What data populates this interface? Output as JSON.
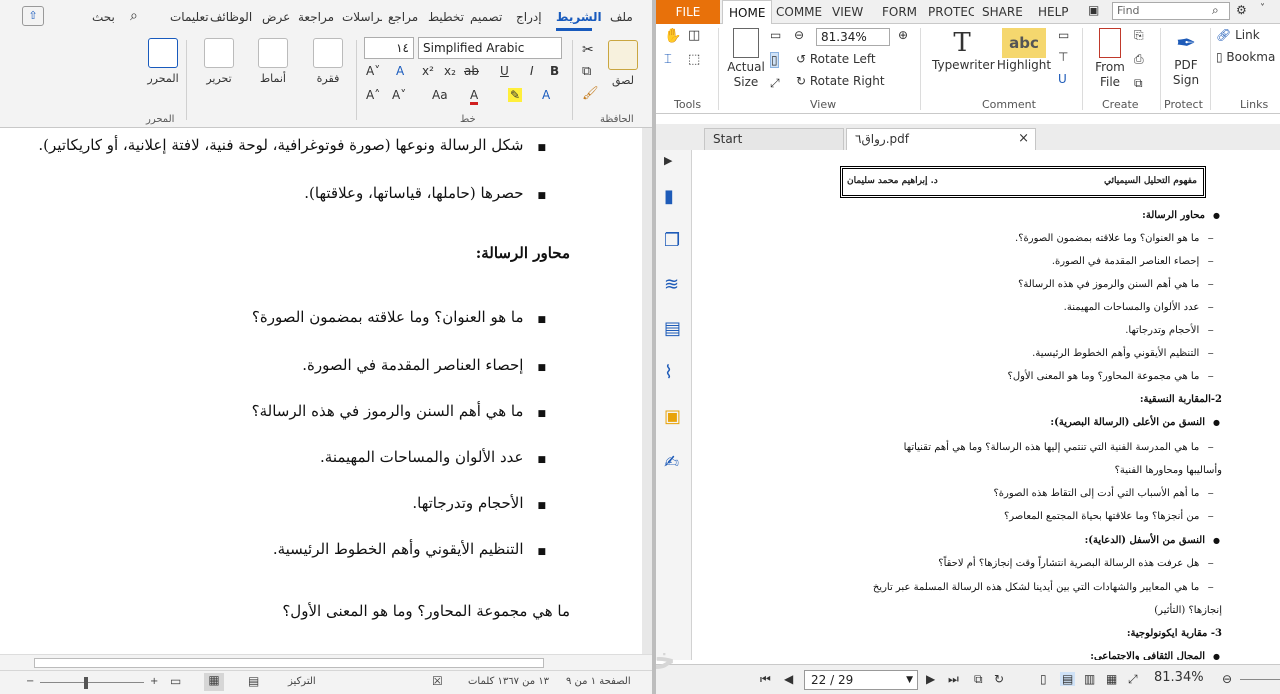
{
  "word": {
    "tabs": [
      "ملف",
      "الشريط",
      "إدراج",
      "تصميم",
      "تخطيط",
      "مراجع",
      "مراسلات",
      "مراجعة",
      "عرض",
      "الوظائف",
      "تعليمات",
      "بحث"
    ],
    "active_tab": "الشريط",
    "ribbon": {
      "paste": "لصق",
      "clipboard_group": "الحافظة",
      "font_name": "Simplified Arabic",
      "font_size": "١٤",
      "font_group": "خط",
      "paragraph": "فقرة",
      "styles": "أنماط",
      "editing": "تحرير",
      "editor": "المحرر",
      "editor_group": "المحرر"
    },
    "document_lines": [
      "شكل الرسالة ونوعها (صورة فوتوغرافية، لوحة فنية، لافتة إعلانية، أو كاريكاتير).",
      "حصرها (حاملها، قياساتها، وعلاقتها).",
      "محاور الرسالة:",
      "ما هو العنوان؟ وما علاقته بمضمون الصورة؟",
      "إحصاء العناصر المقدمة في الصورة.",
      "ما هي أهم السنن والرموز في هذه الرسالة؟",
      "عدد الألوان والمساحات المهيمنة.",
      "الأحجام وتدرجاتها.",
      "التنظيم الأيقوني وأهم الخطوط الرئيسية.",
      "ما هي مجموعة المحاور؟ وما هو المعنى الأول؟"
    ],
    "status": {
      "page": "الصفحة ١ من ٩",
      "words": "١٣ من ١٣٦٧ كلمات",
      "focus": "التركيز"
    }
  },
  "pdf": {
    "file_tab": "FILE",
    "tabs": [
      "HOME",
      "COMME",
      "VIEW",
      "FORM",
      "PROTEC",
      "SHARE",
      "HELP"
    ],
    "find_placeholder": "Find",
    "ribbon": {
      "actual_size": "Actual Size",
      "zoom": "81.34%",
      "rotate_left": "Rotate Left",
      "rotate_right": "Rotate Right",
      "typewriter": "Typewriter",
      "highlight": "Highlight",
      "from_file": "From File",
      "pdf_sign": "PDF Sign",
      "link": "Link",
      "bookmark": "Bookma",
      "groups": [
        "Tools",
        "View",
        "Comment",
        "Create",
        "Protect",
        "Links"
      ]
    },
    "doc_tabs": [
      "Start",
      "رواق٦.pdf"
    ],
    "page_header": {
      "right": "مفهوم التحليل السيميائي",
      "left": "د. إبراهيم محمد سليمان"
    },
    "page_lines": [
      "محاور الرسالة:",
      "ما هو العنوان؟ وما علاقته بمضمون الصورة؟.",
      "إحصاء العناصر المقدمة في الصورة.",
      "ما هي أهم السنن والرموز في هذه الرسالة؟",
      "عدد الألوان والمساحات المهيمنة.",
      "الأحجام وتدرجاتها.",
      "التنظيم الأيقوني وأهم الخطوط الرئيسية.",
      "ما هي مجموعة المحاور؟ وما هو المعنى الأول؟",
      "2-المقاربة النسقية:",
      "النسق من الأعلى (الرسالة البصرية):",
      "ما هي المدرسة الفنية التي تنتمي إليها هذه الرسالة؟ وما هي أهم تقنياتها",
      "وأساليبها ومحاورها الفنية؟",
      "ما أهم الأسباب التي أدت إلى التقاط هذه الصورة؟",
      "من أنجزها؟ وما علاقتها بحياة المجتمع المعاصر؟",
      "النسق من الأسفل (الدعاية):",
      "هل عرفت هذه الرسالة البصرية انتشاراً وقت إنجازها؟ أم لاحقاً؟",
      "ما هي المعايير والشهادات التي بين أيدينا لشكل هذه الرسالة المسلمة عبر تاريخ",
      "إنجازها؟ (التأثير)",
      "3- مقاربة ايكونولوجية:",
      "المجال الثقافي والاجتماعي:"
    ],
    "pager": "22 / 29",
    "zoom_status": "81.34%"
  }
}
